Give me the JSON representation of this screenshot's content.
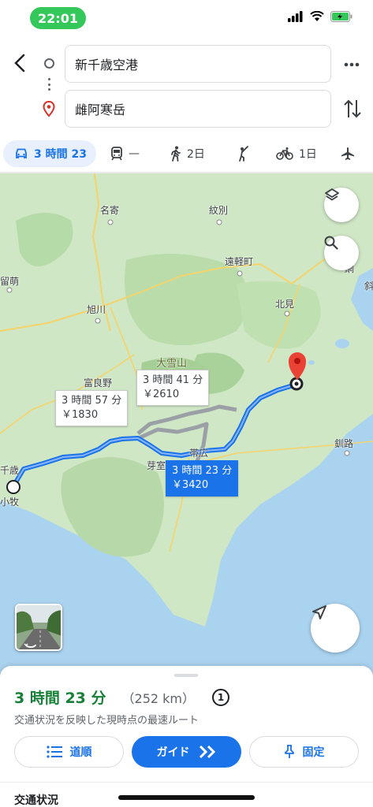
{
  "status_bar": {
    "time": "22:01"
  },
  "search": {
    "origin": "新千歳空港",
    "destination": "雌阿寒岳"
  },
  "modes": [
    {
      "icon": "car-icon",
      "label": "3 時間 23",
      "active": true
    },
    {
      "icon": "train-icon",
      "label": "—"
    },
    {
      "icon": "walk-icon",
      "label": "2日"
    },
    {
      "icon": "rideshare-icon",
      "label": ""
    },
    {
      "icon": "bike-icon",
      "label": "1日"
    },
    {
      "icon": "flight-icon",
      "label": ""
    }
  ],
  "map": {
    "labels": {
      "nayoro": "名寄",
      "monbetsu": "紋別",
      "engaru": "遠軽町",
      "rumoi": "留萌",
      "asahikawa": "旭川",
      "kitami": "北見",
      "abashiri": "網",
      "shari": "斜",
      "daisetsuzan": "大雪山",
      "furano": "富良野",
      "memuro": "芽室",
      "obihiro": "帯広",
      "kushiro": "釧路",
      "chitose": "千歳",
      "tomakomai": "小牧"
    },
    "routes": [
      {
        "line1": "3 時間 57 分",
        "line2": "￥1830",
        "selected": false
      },
      {
        "line1": "3 時間 41 分",
        "line2": "￥2610",
        "selected": false
      },
      {
        "line1": "3 時間 23 分",
        "line2": "￥3420",
        "selected": true
      }
    ]
  },
  "sheet": {
    "duration": "3 時間 23 分",
    "distance": "（252 km）",
    "toll_badge": "1",
    "subtitle": "交通状況を反映した現時点の最速ルート",
    "steps_label": "道順",
    "guide_label": "ガイド",
    "pin_label": "固定",
    "traffic_label": "交通状況"
  },
  "colors": {
    "accent": "#1a73e8",
    "duration_green": "#188038",
    "route_blue": "#1a73e8",
    "route_gray": "#9aa0a6"
  }
}
